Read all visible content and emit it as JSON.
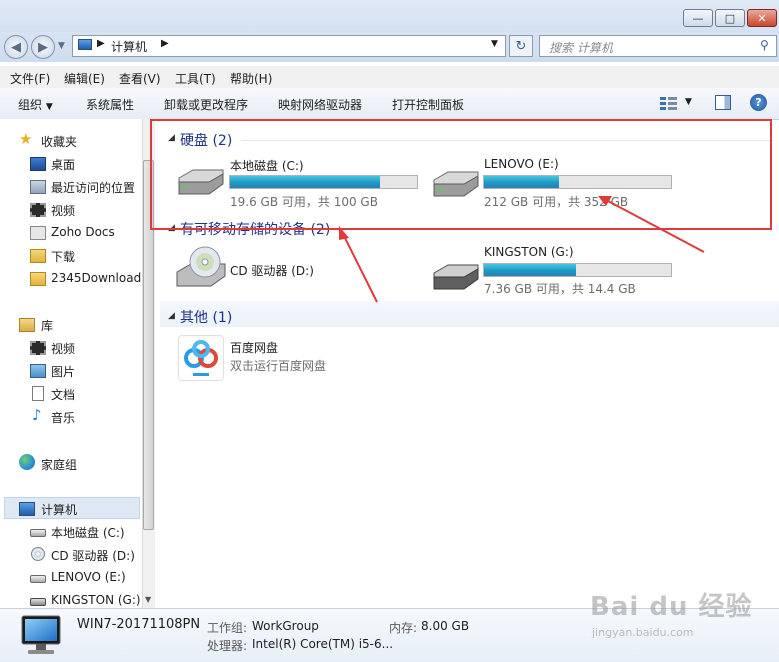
{
  "window": {
    "minimize": "—",
    "maximize": "□",
    "close": "✕"
  },
  "address": {
    "path": "计算机",
    "search_placeholder": "搜索 计算机"
  },
  "menubar": [
    "文件(F)",
    "编辑(E)",
    "查看(V)",
    "工具(T)",
    "帮助(H)"
  ],
  "toolbar": [
    "组织",
    "系统属性",
    "卸载或更改程序",
    "映射网络驱动器",
    "打开控制面板"
  ],
  "nav": {
    "favorites_header": "收藏夹",
    "favorites": [
      "桌面",
      "最近访问的位置",
      "视频",
      "Zoho Docs",
      "下载",
      "2345Download"
    ],
    "libraries_header": "库",
    "libraries": [
      "视频",
      "图片",
      "文档",
      "音乐"
    ],
    "homegroup": "家庭组",
    "computer_header": "计算机",
    "computer_items": [
      "本地磁盘 (C:)",
      "CD 驱动器 (D:)",
      "LENOVO (E:)",
      "KINGSTON (G:)"
    ]
  },
  "groups": {
    "hdd": "硬盘 (2)",
    "removable": "有可移动存储的设备 (2)",
    "other": "其他 (1)"
  },
  "drives": [
    {
      "name": "本地磁盘 (C:)",
      "info": "19.6 GB 可用，共 100 GB",
      "used_fraction": 0.8
    },
    {
      "name": "LENOVO (E:)",
      "info": "212 GB 可用，共 352 GB",
      "used_fraction": 0.4
    },
    {
      "name": "CD 驱动器 (D:)"
    },
    {
      "name": "KINGSTON (G:)",
      "info": "7.36 GB 可用，共 14.4 GB",
      "used_fraction": 0.49
    }
  ],
  "other": {
    "name": "百度网盘",
    "desc": "双击运行百度网盘"
  },
  "details": {
    "computer_name": "WIN7-20171108PN",
    "workgroup_label": "工作组:",
    "workgroup": "WorkGroup",
    "memory_label": "内存:",
    "memory": "8.00 GB",
    "cpu_label": "处理器:",
    "cpu": "Intel(R) Core(TM) i5-6..."
  },
  "watermark": {
    "brand": "Bai du 经验",
    "url": "jingyan.baidu.com"
  },
  "colors": {
    "annotation_red": "#e03a3a",
    "group_header": "#1e3287",
    "bar_fill": "#1d9ac4"
  }
}
